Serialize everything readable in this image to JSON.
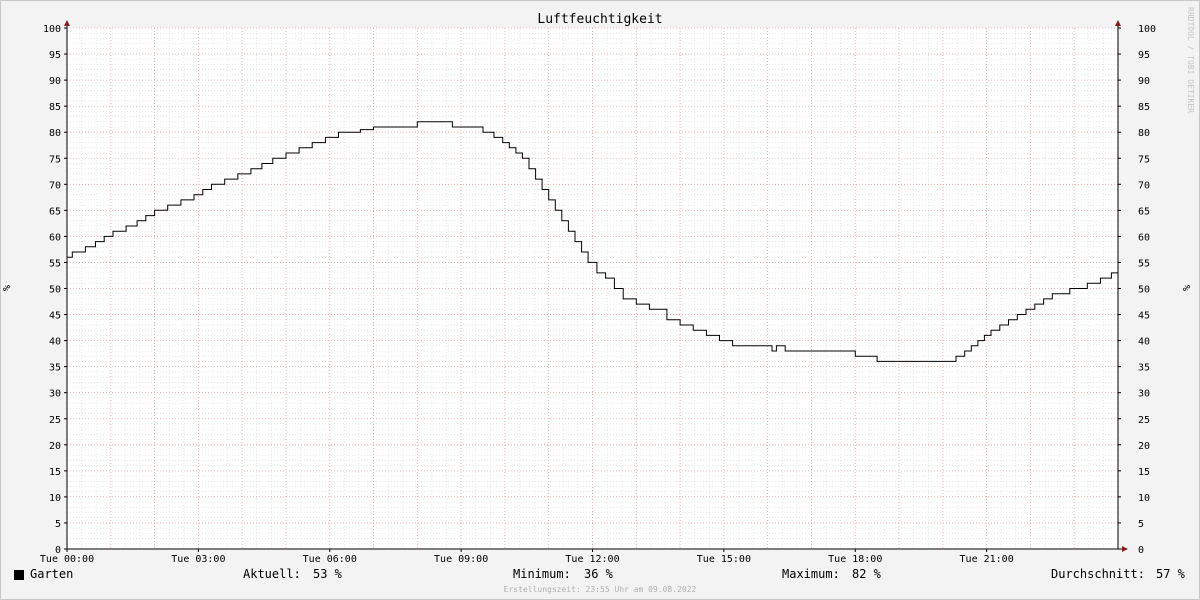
{
  "chart_data": {
    "type": "line",
    "title": "Luftfeuchtigkeit",
    "ylabel_left": "%",
    "ylabel_right": "%",
    "watermark": "RRDTOOL / TOBI OETIKER",
    "ylim": [
      0,
      100
    ],
    "y_major_step": 5,
    "y_minor_step": 1,
    "x_hours_range": [
      0,
      24
    ],
    "x_ticks": [
      {
        "h": 0,
        "label": "Tue 00:00"
      },
      {
        "h": 3,
        "label": "Tue 03:00"
      },
      {
        "h": 6,
        "label": "Tue 06:00"
      },
      {
        "h": 9,
        "label": "Tue 09:00"
      },
      {
        "h": 12,
        "label": "Tue 12:00"
      },
      {
        "h": 15,
        "label": "Tue 15:00"
      },
      {
        "h": 18,
        "label": "Tue 18:00"
      },
      {
        "h": 21,
        "label": "Tue 21:00"
      }
    ],
    "x_major_hours": [
      1,
      2,
      3,
      4,
      5,
      6,
      7,
      8,
      9,
      10,
      11,
      12,
      13,
      14,
      15,
      16,
      17,
      18,
      19,
      20,
      21,
      22,
      23
    ],
    "series": [
      {
        "name": "Garten",
        "color": "#000000",
        "x": [
          0,
          0.12,
          0.42,
          0.65,
          0.85,
          1.05,
          1.35,
          1.6,
          1.8,
          2.0,
          2.3,
          2.6,
          2.9,
          3.1,
          3.3,
          3.6,
          3.9,
          4.2,
          4.45,
          4.7,
          5.0,
          5.3,
          5.6,
          5.9,
          6.2,
          6.4,
          6.7,
          7.0,
          7.3,
          8.0,
          8.8,
          9.5,
          9.75,
          9.95,
          10.1,
          10.25,
          10.4,
          10.55,
          10.7,
          10.85,
          11.0,
          11.15,
          11.3,
          11.45,
          11.6,
          11.75,
          11.9,
          12.1,
          12.3,
          12.5,
          12.7,
          13.0,
          13.3,
          13.7,
          14.0,
          14.3,
          14.6,
          14.9,
          15.2,
          15.7,
          16.0,
          16.1,
          16.2,
          16.4,
          17.0,
          17.6,
          18.0,
          18.5,
          19.0,
          19.6,
          20.0,
          20.3,
          20.5,
          20.65,
          20.8,
          20.95,
          21.1,
          21.3,
          21.5,
          21.7,
          21.9,
          22.1,
          22.3,
          22.5,
          22.7,
          22.9,
          23.3,
          23.6,
          23.85,
          24.0
        ],
        "values": [
          56,
          57,
          58,
          59,
          60,
          61,
          62,
          63,
          64,
          65,
          66,
          67,
          68,
          69,
          70,
          71,
          72,
          73,
          74,
          75,
          76,
          77,
          78,
          79,
          80,
          80,
          80.5,
          81,
          81,
          82,
          81,
          80,
          79,
          78,
          77,
          76,
          75,
          73,
          71,
          69,
          67,
          65,
          63,
          61,
          59,
          57,
          55,
          53,
          52,
          50,
          48,
          47,
          46,
          44,
          43,
          42,
          41,
          40,
          39,
          39,
          39,
          38,
          39,
          38,
          38,
          38,
          37,
          36,
          36,
          36,
          36,
          37,
          38,
          39,
          40,
          41,
          42,
          43,
          44,
          45,
          46,
          47,
          48,
          49,
          49,
          50,
          51,
          52,
          53,
          53
        ]
      }
    ]
  },
  "legend": {
    "series_name": "Garten",
    "current_label": "Aktuell:",
    "current_value": "53 %",
    "min_label": "Minimum:",
    "min_value": "36 %",
    "max_label": "Maximum:",
    "max_value": "82 %",
    "avg_label": "Durchschnitt:",
    "avg_value": "57 %"
  },
  "footer": "Erstellungszeit: 23:55 Uhr am 09.08.2022"
}
